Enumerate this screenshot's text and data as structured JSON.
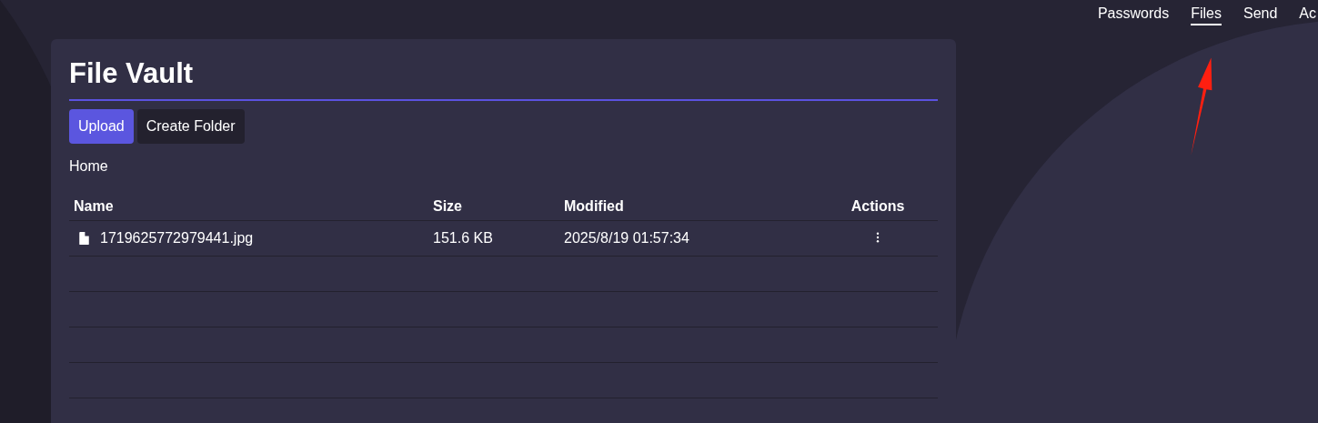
{
  "nav": [
    {
      "label": "Passwords",
      "selected": false
    },
    {
      "label": "Files",
      "selected": true
    },
    {
      "label": "Send",
      "selected": false
    },
    {
      "label": "Ac",
      "selected": false
    }
  ],
  "title": "File Vault",
  "buttons": [
    {
      "label": "Upload",
      "kind": "primary"
    },
    {
      "label": "Create Folder",
      "kind": "secondary"
    }
  ],
  "breadcrumb": "Home",
  "table": {
    "columns": [
      "Name",
      "Size",
      "Modified",
      "Actions"
    ],
    "rows": [
      {
        "name": "1719625772979441.jpg",
        "size": "151.6 KB",
        "modified": "2025/8/19 01:57:34"
      }
    ]
  }
}
